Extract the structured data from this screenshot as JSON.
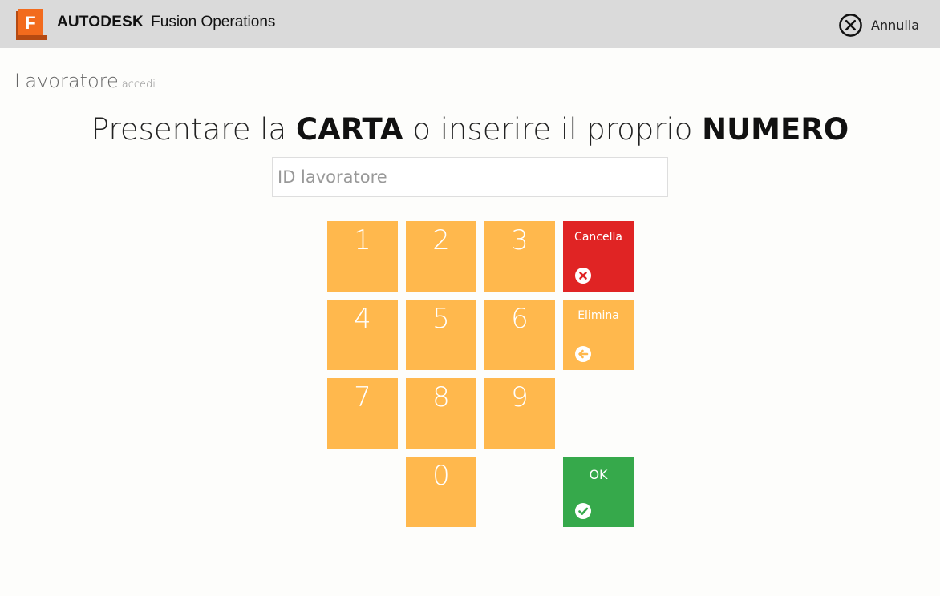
{
  "header": {
    "logo_letter": "F",
    "brand_company": "AUTODESK",
    "brand_product": "Fusion Operations",
    "cancel_label": "Annulla",
    "colors": {
      "bar": "#dadada",
      "logo_orange": "#f26b1d"
    }
  },
  "page": {
    "title": "Lavoratore",
    "subtitle": "accedi",
    "instruction": {
      "part1": "Presentare la ",
      "strong1": "CARTA",
      "part2": " o inserire il proprio ",
      "strong2": "NUMERO"
    }
  },
  "input": {
    "placeholder": "ID lavoratore",
    "value": ""
  },
  "keypad": {
    "digits": [
      "1",
      "2",
      "3",
      "4",
      "5",
      "6",
      "7",
      "8",
      "9",
      "0"
    ],
    "cancel_label": "Cancella",
    "delete_label": "Elimina",
    "ok_label": "OK",
    "colors": {
      "digit": "#ffb84d",
      "cancel": "#e02424",
      "ok": "#36a94b"
    }
  }
}
